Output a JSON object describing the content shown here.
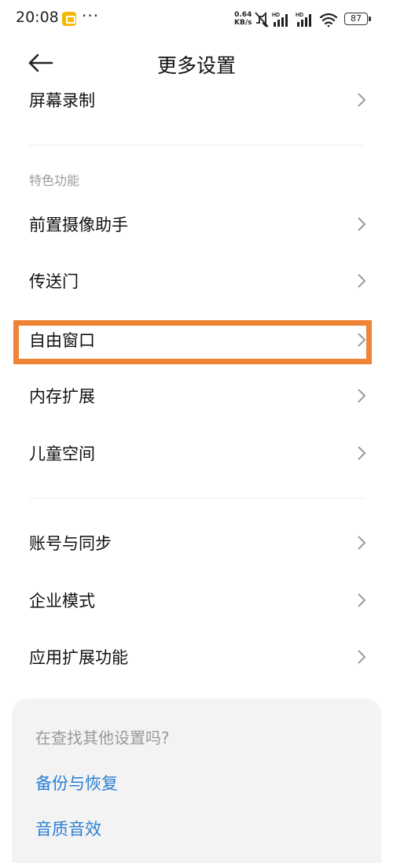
{
  "status_bar": {
    "time": "20:08",
    "more": "···",
    "net_speed_value": "0.64",
    "net_speed_unit": "KB/s",
    "hd_label": "HD",
    "battery": "87"
  },
  "header": {
    "title": "更多设置"
  },
  "items_top": [
    {
      "label": "屏幕录制"
    }
  ],
  "section_features": {
    "header": "特色功能",
    "items": [
      {
        "label": "前置摄像助手"
      },
      {
        "label": "传送门"
      },
      {
        "label": "自由窗口",
        "highlighted": true
      },
      {
        "label": "内存扩展"
      },
      {
        "label": "儿童空间"
      }
    ]
  },
  "section_other": {
    "items": [
      {
        "label": "账号与同步"
      },
      {
        "label": "企业模式"
      },
      {
        "label": "应用扩展功能"
      }
    ]
  },
  "suggestion_card": {
    "title": "在查找其他设置吗?",
    "links": [
      {
        "label": "备份与恢复"
      },
      {
        "label": "音质音效"
      }
    ]
  },
  "colors": {
    "highlight": "#ef8435",
    "link": "#2a7fd4",
    "section_header": "#9a9a9a"
  }
}
